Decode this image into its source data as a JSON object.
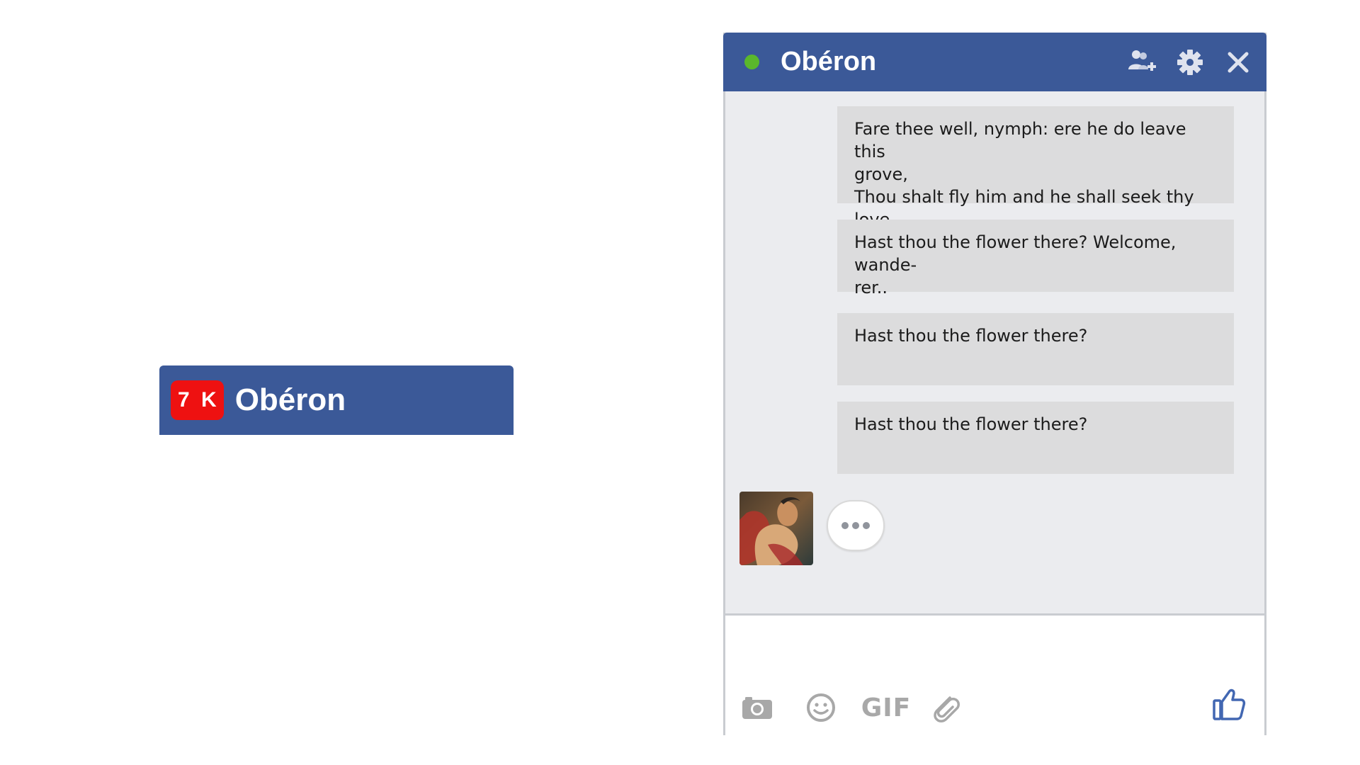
{
  "minimized_chat": {
    "badge": "7 K",
    "name": "Obéron"
  },
  "chat": {
    "title": "Obéron",
    "status": "online",
    "header_icons": [
      "add-friend-icon",
      "gear-icon",
      "close-icon"
    ],
    "messages": [
      {
        "lines": [
          "Fare thee well, nymph: ere he do leave this",
          "grove,",
          "Thou shalt fly him and he shall seek thy love."
        ]
      },
      {
        "lines": [
          "Hast thou the flower there? Welcome, wande-",
          "rer.."
        ]
      },
      {
        "lines": [
          "Hast thou the flower there?"
        ]
      },
      {
        "lines": [
          "Hast thou the flower there?"
        ]
      }
    ],
    "typing_indicator": "typing-dots-icon",
    "composer": {
      "tools": [
        "camera-icon",
        "emoji-icon",
        "gif-button",
        "attachment-icon"
      ],
      "gif_label": "GIF",
      "send_icon": "thumbs-up-icon"
    }
  },
  "colors": {
    "header": "#3b5998",
    "badge": "#ee1111",
    "online": "#5ab82c",
    "bubble": "#dcdcdd",
    "chat_bg": "#ebecef",
    "like": "#4267b2"
  }
}
